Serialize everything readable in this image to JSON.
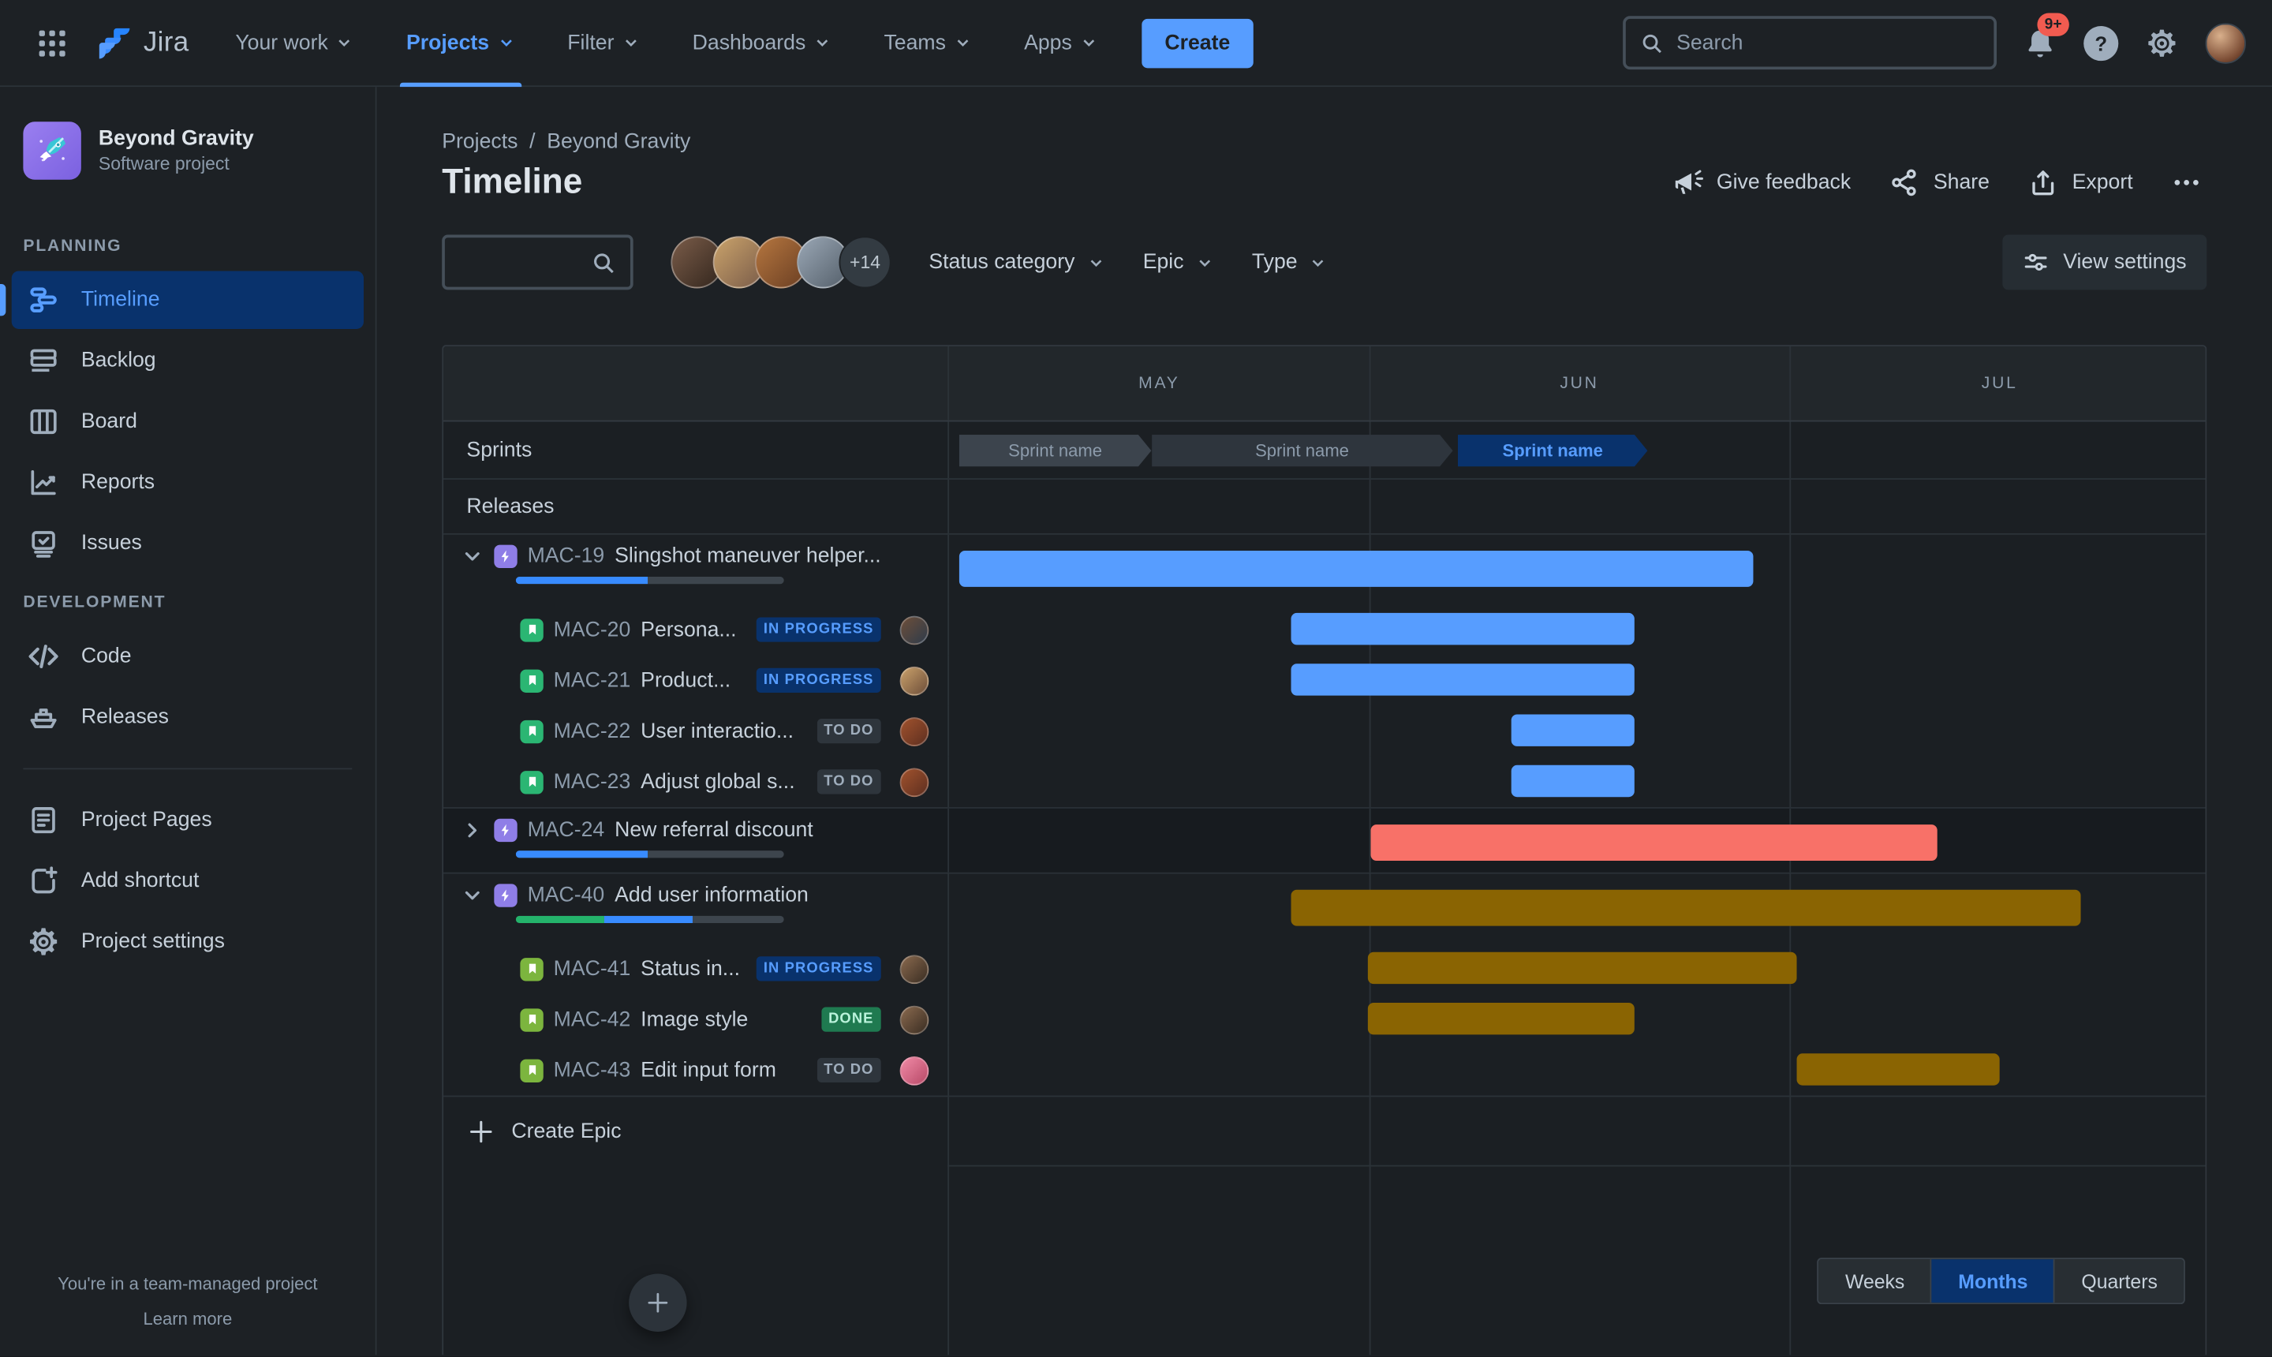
{
  "topnav": {
    "logo_text": "Jira",
    "items": [
      {
        "label": "Your work"
      },
      {
        "label": "Projects"
      },
      {
        "label": "Filter"
      },
      {
        "label": "Dashboards"
      },
      {
        "label": "Teams"
      },
      {
        "label": "Apps"
      }
    ],
    "active_item": "Projects",
    "create_label": "Create",
    "search_placeholder": "Search",
    "notifications_badge": "9+",
    "help_glyph": "?"
  },
  "sidebar": {
    "project": {
      "name": "Beyond Gravity",
      "type": "Software project"
    },
    "planning_label": "PLANNING",
    "planning": [
      "Timeline",
      "Backlog",
      "Board",
      "Reports",
      "Issues"
    ],
    "active_planning_item": "Timeline",
    "development_label": "DEVELOPMENT",
    "development": [
      "Code",
      "Releases"
    ],
    "extra": [
      "Project Pages",
      "Add shortcut",
      "Project settings"
    ],
    "footer_note": "You're in a team-managed project",
    "footer_link": "Learn more"
  },
  "header": {
    "breadcrumb": [
      "Projects",
      "Beyond Gravity"
    ],
    "separator": "/",
    "title": "Timeline",
    "actions": {
      "feedback": "Give feedback",
      "share": "Share",
      "export": "Export",
      "more": "•••"
    }
  },
  "filters": {
    "avatar_overflow": "+14",
    "avatars": [
      {
        "css": "background:linear-gradient(135deg,#7a5c49,#33261d)"
      },
      {
        "css": "background:linear-gradient(135deg,#caa36b,#7a5c49)"
      },
      {
        "css": "background:linear-gradient(135deg,#b5763f,#6b3f23)"
      },
      {
        "css": "background:linear-gradient(135deg,#9aa7b5,#55606b)"
      }
    ],
    "dropdowns": [
      "Status category",
      "Epic",
      "Type"
    ],
    "view_settings": "View settings"
  },
  "timeline": {
    "months": [
      "MAY",
      "JUN",
      "JUL"
    ],
    "sprints_label": "Sprints",
    "releases_label": "Releases",
    "sprints": [
      {
        "label": "Sprint name",
        "css": "left:0.8%;width:15.3%;background:#3C444D;color:#8C9BAB"
      },
      {
        "label": "Sprint name",
        "css": "left:16.1%;width:24.0%;background:#2E353D;color:#8C9BAB"
      },
      {
        "label": "Sprint name",
        "css": "left:40.5%;width:15.1%;background:#09326C;color:#579DFF;font-weight:700"
      }
    ],
    "epics": [
      {
        "key": "MAC-19",
        "title": "Slingshot maneuver helper...",
        "expanded": true,
        "bar_css": "left:0.8%;width:63.2%;background:#579DFF",
        "progress": [
          {
            "css": "width:49%;background:#388BFF"
          }
        ],
        "children": [
          {
            "key": "MAC-20",
            "title": "Persona...",
            "status": "IN PROGRESS",
            "badge_css": "background:#09326C;color:#579DFF",
            "bar_css": "left:27.2%;width:27.4%;background:#579DFF",
            "avatar_css": "background:linear-gradient(135deg,#6e4f3a,#2e3b4a)"
          },
          {
            "key": "MAC-21",
            "title": "Product...",
            "status": "IN PROGRESS",
            "badge_css": "background:#09326C;color:#579DFF",
            "bar_css": "left:27.2%;width:27.4%;background:#579DFF",
            "avatar_css": "background:linear-gradient(135deg,#c9a06a,#6e4f3a)"
          },
          {
            "key": "MAC-22",
            "title": "User interactio...",
            "status": "TO DO",
            "badge_css": "background:#2E353C;color:#9FADBC",
            "bar_css": "left:44.7%;width:9.9%;background:#579DFF",
            "avatar_css": "background:linear-gradient(135deg,#a0522d,#5e2f20)"
          },
          {
            "key": "MAC-23",
            "title": "Adjust global s...",
            "status": "TO DO",
            "badge_css": "background:#2E353C;color:#9FADBC",
            "bar_css": "left:44.7%;width:9.9%;background:#579DFF",
            "avatar_css": "background:linear-gradient(135deg,#a0522d,#5e2f20)"
          }
        ]
      },
      {
        "key": "MAC-24",
        "title": "New referral discount",
        "expanded": false,
        "bar_css": "left:33.6%;width:45.1%;background:#F87168",
        "progress": [
          {
            "css": "width:49%;background:#388BFF"
          }
        ],
        "children": []
      },
      {
        "key": "MAC-40",
        "title": "Add user information",
        "expanded": true,
        "bar_css": "left:27.2%;width:62.9%;background:#8A6402",
        "progress": [
          {
            "css": "width:33%;background:#24B36B"
          },
          {
            "css": "width:33%;background:#388BFF"
          }
        ],
        "children": [
          {
            "key": "MAC-41",
            "title": "Status in...",
            "status": "IN PROGRESS",
            "badge_css": "background:#09326C;color:#579DFF",
            "bar_css": "left:33.3%;width:34.2%;background:#8A6402",
            "avatar_css": "background:linear-gradient(135deg,#8a6a4f,#3a2d22)"
          },
          {
            "key": "MAC-42",
            "title": "Image style",
            "status": "DONE",
            "badge_css": "background:#1F7A50;color:#BAF3DB",
            "bar_css": "left:33.3%;width:21.3%;background:#8A6402",
            "avatar_css": "background:linear-gradient(135deg,#8a6a4f,#3a2d22)"
          },
          {
            "key": "MAC-43",
            "title": "Edit input form",
            "status": "TO DO",
            "badge_css": "background:#2E353C;color:#9FADBC",
            "bar_css": "left:67.5%;width:16.1%;background:#8A6402",
            "avatar_css": "background:linear-gradient(135deg,#f08aa6,#b84a68)"
          }
        ]
      }
    ],
    "create_epic": "Create Epic",
    "zoom": {
      "options": [
        "Weeks",
        "Months",
        "Quarters"
      ],
      "active": "Months"
    }
  },
  "colors": {
    "accent_blue": "#579DFF",
    "selected_bg": "#09326C",
    "bar_blue": "#579DFF",
    "bar_red": "#F87168",
    "bar_yellow": "#8A6402",
    "epic_purple": "#8F7EE7",
    "story_green": "#2BB673",
    "story_lime": "#7CB53E",
    "notification_red": "#F15B50",
    "done_green": "#1F7A50"
  }
}
